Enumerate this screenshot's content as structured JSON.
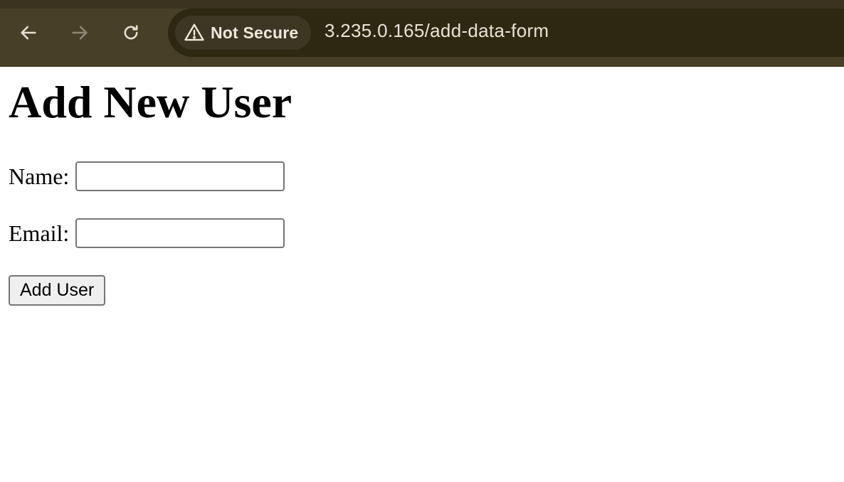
{
  "browser": {
    "security_label": "Not Secure",
    "url": "3.235.0.165/add-data-form",
    "icons": {
      "back": "arrow-left-icon",
      "forward": "arrow-right-icon",
      "reload": "reload-icon",
      "security": "warning-triangle-icon"
    },
    "colors": {
      "toolbar": "#483f29",
      "omnibox": "#2e2712",
      "chip": "#3d3623",
      "text": "#efe9dd"
    }
  },
  "page": {
    "title": "Add New User",
    "form": {
      "name_label": "Name:",
      "name_value": "",
      "email_label": "Email:",
      "email_value": "",
      "submit_label": "Add User"
    }
  }
}
